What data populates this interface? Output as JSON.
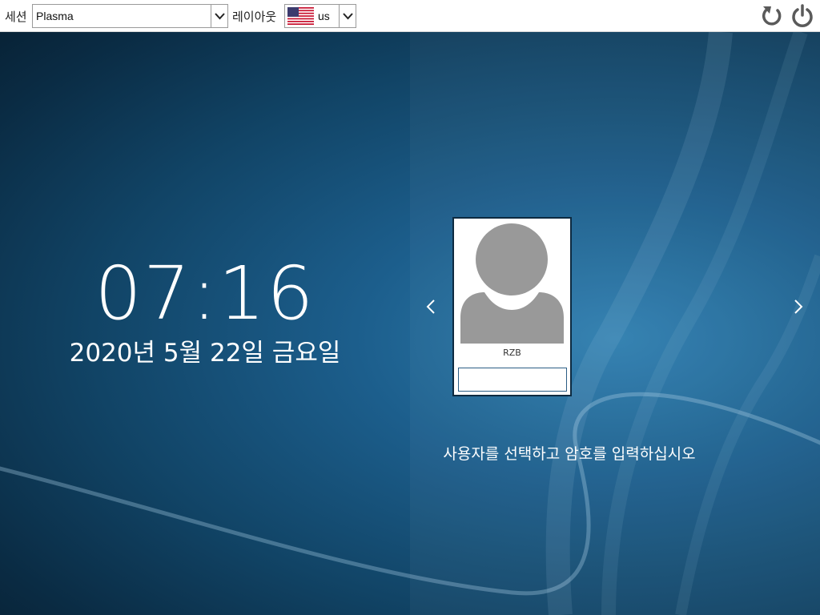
{
  "topbar": {
    "session_label": "세션",
    "session_value": "Plasma",
    "layout_label": "레이아웃",
    "layout_value": "us",
    "layout_flag_icon": "us-flag-icon",
    "reboot_icon": "reboot-icon",
    "shutdown_icon": "power-icon"
  },
  "clock": {
    "time": "07:16",
    "date": "2020년 5월 22일 금요일"
  },
  "login": {
    "user_name": "RZB",
    "avatar_icon": "user-avatar-icon",
    "password_value": "",
    "prev_icon": "chevron-left-icon",
    "next_icon": "chevron-right-icon",
    "prompt": "사용자를 선택하고 암호를 입력하십시오"
  },
  "colors": {
    "background_dark": "#0a2b43",
    "background_light": "#2f7fb0",
    "topbar": "#ffffff",
    "avatar_gray": "#999999",
    "text_light": "#ffffff"
  }
}
